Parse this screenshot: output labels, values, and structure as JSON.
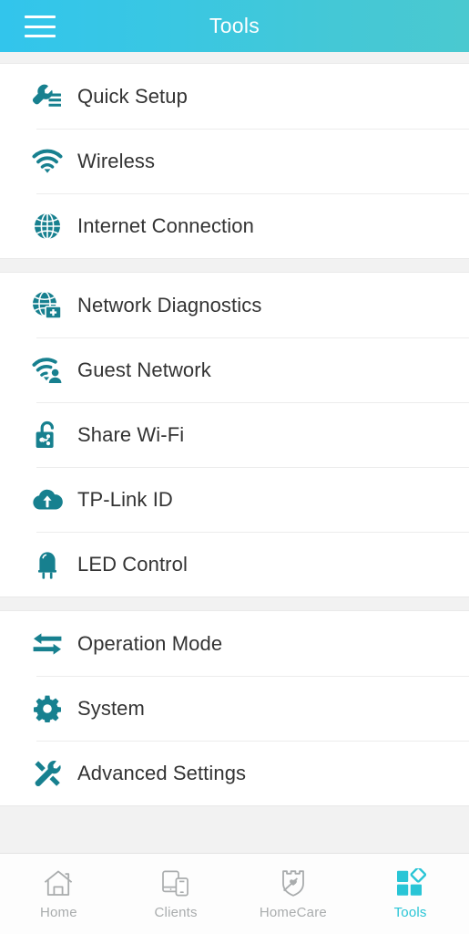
{
  "header": {
    "title": "Tools",
    "menu_icon": "hamburger-menu-icon",
    "gradient_start": "#32c5ec",
    "gradient_end": "#4ac9d0"
  },
  "theme": {
    "icon_teal": "#17808f",
    "active_tab": "#29c5d6",
    "label_color": "#333333",
    "page_background": "#f2f2f2",
    "row_background": "#ffffff",
    "divider": "#ececec"
  },
  "groups": [
    {
      "items": [
        {
          "label": "Quick Setup",
          "icon": "wrench-settings-icon"
        },
        {
          "label": "Wireless",
          "icon": "wifi-icon"
        },
        {
          "label": "Internet Connection",
          "icon": "globe-icon"
        }
      ]
    },
    {
      "items": [
        {
          "label": "Network Diagnostics",
          "icon": "globe-medical-kit-icon"
        },
        {
          "label": "Guest Network",
          "icon": "wifi-person-icon"
        },
        {
          "label": "Share Wi-Fi",
          "icon": "unlocked-padlock-share-icon"
        },
        {
          "label": "TP-Link ID",
          "icon": "cloud-upload-icon"
        },
        {
          "label": "LED Control",
          "icon": "led-bulb-icon"
        }
      ]
    },
    {
      "items": [
        {
          "label": "Operation Mode",
          "icon": "two-way-arrows-icon"
        },
        {
          "label": "System",
          "icon": "gear-icon"
        },
        {
          "label": "Advanced Settings",
          "icon": "wrench-screwdriver-icon"
        }
      ]
    }
  ],
  "tabbar": {
    "tabs": [
      {
        "label": "Home",
        "icon": "house-icon",
        "active": false
      },
      {
        "label": "Clients",
        "icon": "tablet-phone-icon",
        "active": false
      },
      {
        "label": "HomeCare",
        "icon": "shield-heart-icon",
        "active": false
      },
      {
        "label": "Tools",
        "icon": "squares-diamond-icon",
        "active": true
      }
    ]
  }
}
